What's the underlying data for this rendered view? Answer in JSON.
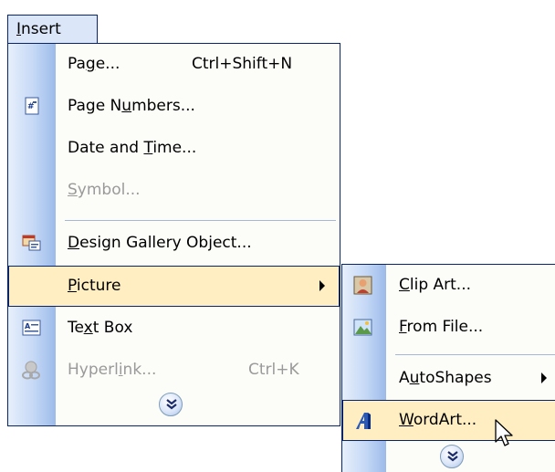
{
  "menubar": {
    "insert": {
      "text": "Insert",
      "accel": "I",
      "rest": "nsert"
    }
  },
  "menu": {
    "items": [
      {
        "id": "page",
        "pre": "Pa",
        "accel": "g",
        "post": "e...",
        "shortcut": "Ctrl+Shift+N",
        "icon": null,
        "enabled": true
      },
      {
        "id": "page-numbers",
        "pre": "Page N",
        "accel": "u",
        "post": "mbers...",
        "shortcut": "",
        "icon": "page-numbers-icon",
        "enabled": true
      },
      {
        "id": "date-time",
        "pre": "Date and ",
        "accel": "T",
        "post": "ime...",
        "shortcut": "",
        "icon": null,
        "enabled": true
      },
      {
        "id": "symbol",
        "pre": "",
        "accel": "S",
        "post": "ymbol...",
        "shortcut": "",
        "icon": null,
        "enabled": false
      },
      {
        "id": "design-gallery",
        "pre": "",
        "accel": "D",
        "post": "esign Gallery Object...",
        "shortcut": "",
        "icon": "design-gallery-icon",
        "enabled": true
      },
      {
        "id": "picture",
        "pre": "",
        "accel": "P",
        "post": "icture",
        "shortcut": "",
        "icon": null,
        "enabled": true,
        "submenu": true,
        "highlighted": true
      },
      {
        "id": "text-box",
        "pre": "Te",
        "accel": "x",
        "post": "t Box",
        "shortcut": "",
        "icon": "text-box-icon",
        "enabled": true
      },
      {
        "id": "hyperlink",
        "pre": "Hyperl",
        "accel": "i",
        "post": "nk...",
        "shortcut": "Ctrl+K",
        "icon": "hyperlink-icon",
        "enabled": false
      }
    ],
    "expand_icon": "double-chevron-down-icon"
  },
  "submenu": {
    "items": [
      {
        "id": "clip-art",
        "pre": "",
        "accel": "C",
        "post": "lip Art...",
        "icon": "clip-art-icon"
      },
      {
        "id": "from-file",
        "pre": "",
        "accel": "F",
        "post": "rom File...",
        "icon": "from-file-icon"
      },
      {
        "id": "autoshapes",
        "pre": "A",
        "accel": "u",
        "post": "toShapes",
        "icon": null,
        "submenu": true
      },
      {
        "id": "wordart",
        "pre": "",
        "accel": "W",
        "post": "ordArt...",
        "icon": "wordart-icon",
        "highlighted": true
      }
    ],
    "expand_icon": "double-chevron-down-icon"
  },
  "colors": {
    "border": "#0a246a",
    "highlight": "#ffeec2",
    "gutter_light": "#e7effb",
    "gutter_dark": "#9cbae9",
    "disabled_text": "#9a9a9a"
  }
}
